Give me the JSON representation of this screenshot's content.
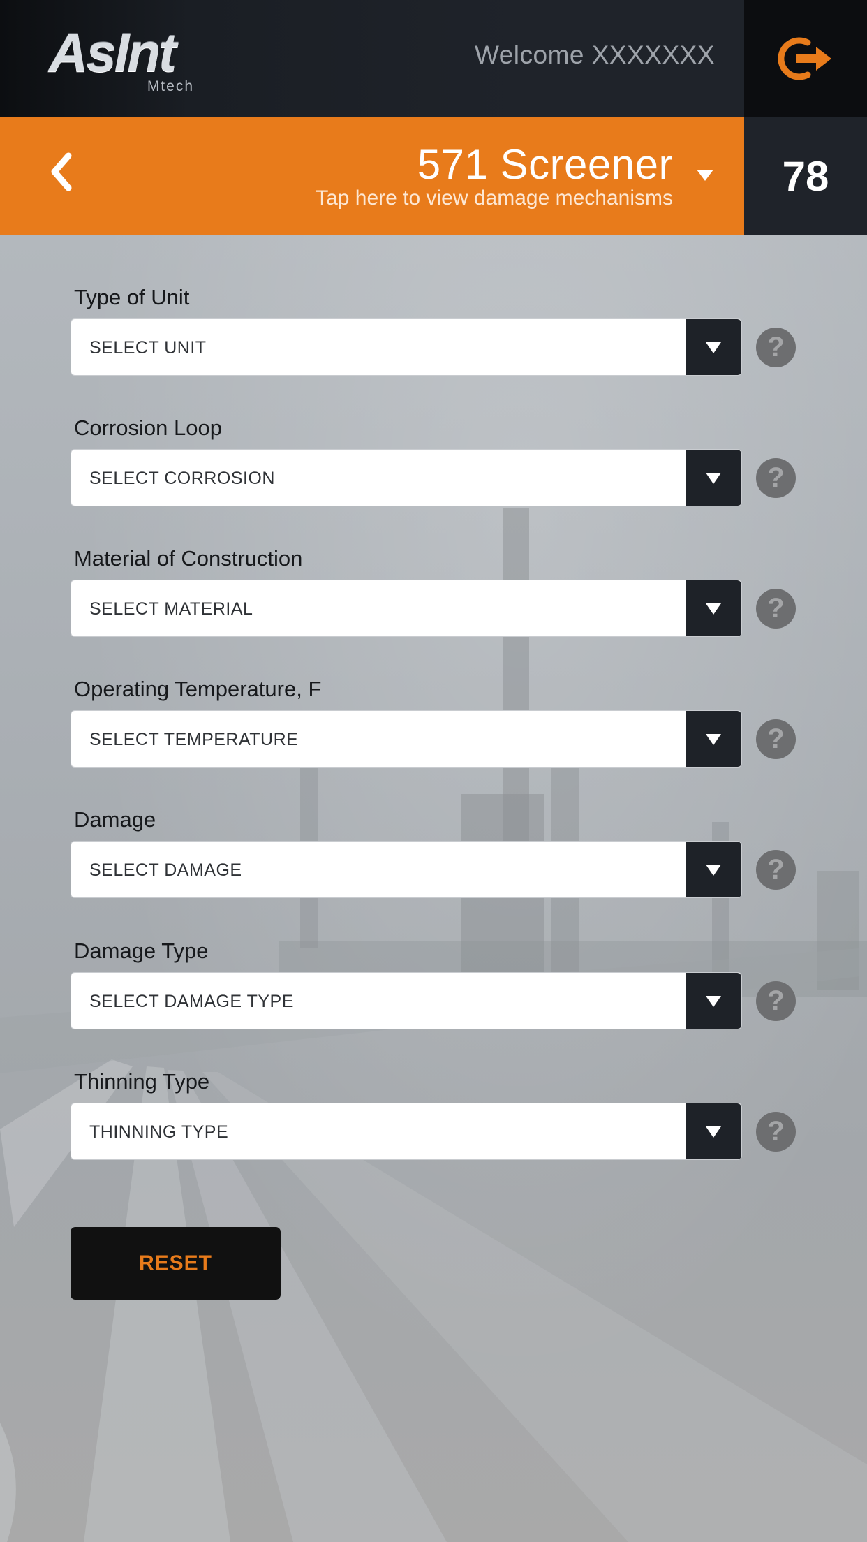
{
  "header": {
    "logo_text": "AsInt",
    "logo_sub": "Mtech",
    "welcome": "Welcome XXXXXXX",
    "logout_icon": "logout-icon"
  },
  "titlebar": {
    "back_icon": "chevron-left-icon",
    "title": "571 Screener",
    "subtitle": "Tap here to view damage mechanisms",
    "dropdown_icon": "caret-down-icon",
    "count": "78"
  },
  "form": {
    "fields": [
      {
        "label": "Type of Unit",
        "value": "SELECT UNIT"
      },
      {
        "label": "Corrosion Loop",
        "value": "SELECT CORROSION"
      },
      {
        "label": "Material of Construction",
        "value": "SELECT MATERIAL"
      },
      {
        "label": "Operating Temperature, F",
        "value": "SELECT TEMPERATURE"
      },
      {
        "label": "Damage",
        "value": "SELECT DAMAGE"
      },
      {
        "label": "Damage Type",
        "value": "SELECT DAMAGE TYPE"
      },
      {
        "label": "Thinning Type",
        "value": "THINNING TYPE"
      }
    ],
    "help_glyph": "?",
    "reset_label": "RESET"
  },
  "colors": {
    "accent": "#e87b1b",
    "dark": "#1f232a",
    "background": "#a9abae"
  }
}
